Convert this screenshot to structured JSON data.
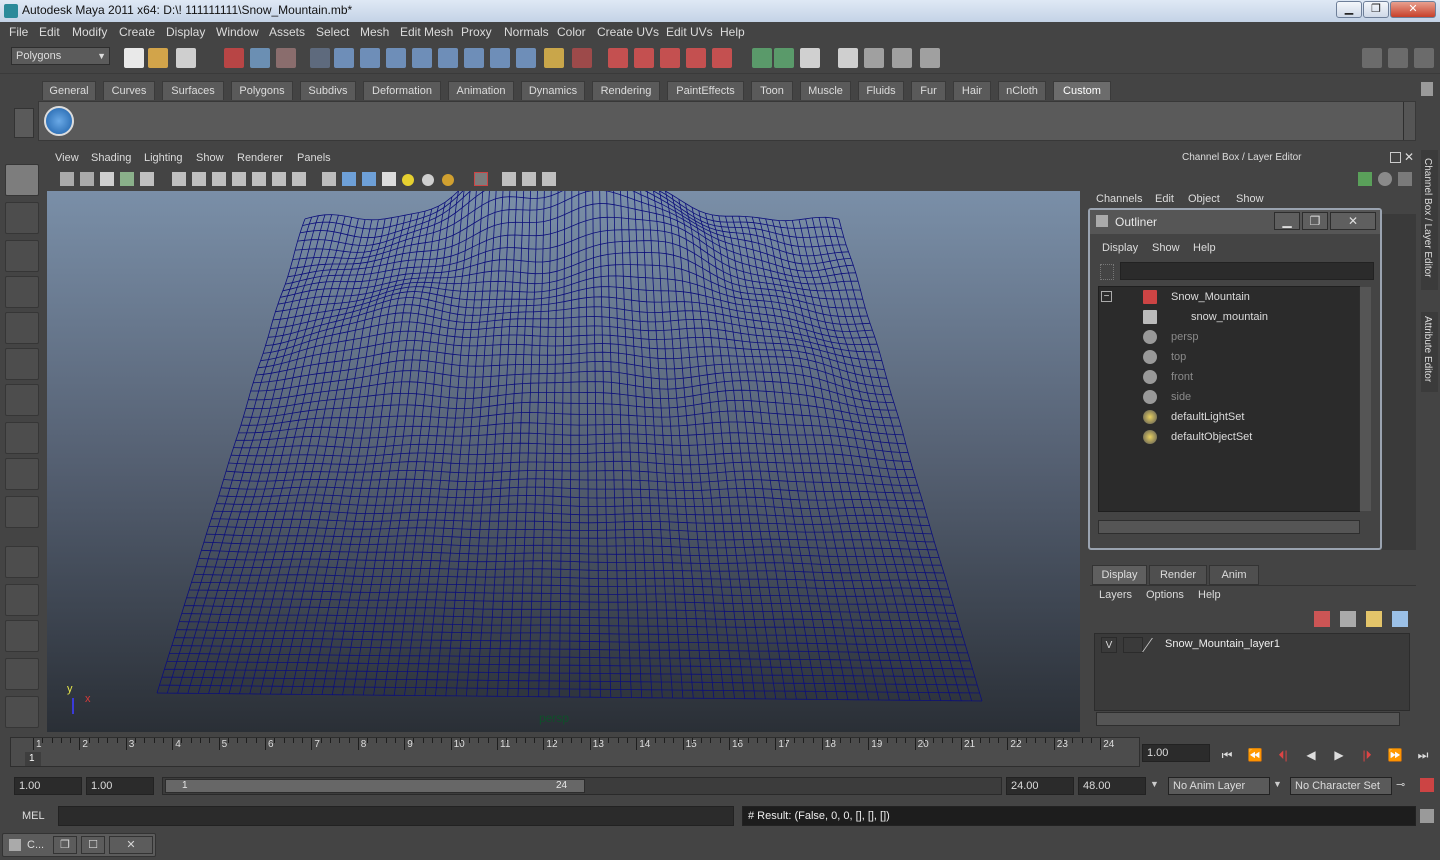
{
  "window": {
    "title": "Autodesk Maya 2011 x64: D:\\! 111111111\\Snow_Mountain.mb*",
    "minimize": "▁",
    "maximize": "❐",
    "close": "✕"
  },
  "menubar": [
    "File",
    "Edit",
    "Modify",
    "Create",
    "Display",
    "Window",
    "Assets",
    "Select",
    "Mesh",
    "Edit Mesh",
    "Proxy",
    "Normals",
    "Color",
    "Create UVs",
    "Edit UVs",
    "Help"
  ],
  "statusline": {
    "mode": "Polygons"
  },
  "shelf": {
    "tabs": [
      "General",
      "Curves",
      "Surfaces",
      "Polygons",
      "Subdivs",
      "Deformation",
      "Animation",
      "Dynamics",
      "Rendering",
      "PaintEffects",
      "Toon",
      "Muscle",
      "Fluids",
      "Fur",
      "Hair",
      "nCloth",
      "Custom"
    ],
    "active_tab": "Custom"
  },
  "viewport": {
    "menu": [
      "View",
      "Shading",
      "Lighting",
      "Show",
      "Renderer",
      "Panels"
    ],
    "camera": "persp",
    "axis_y": "y",
    "axis_x": "x",
    "wire_color": "#0c0f7a"
  },
  "channelbox": {
    "header": "Channel Box / Layer Editor",
    "menu": [
      "Channels",
      "Edit",
      "Object",
      "Show"
    ],
    "side_tabs": [
      "Channel Box / Layer Editor",
      "Attribute Editor"
    ]
  },
  "outliner": {
    "title": "Outliner",
    "menu": [
      "Display",
      "Show",
      "Help"
    ],
    "items": [
      {
        "label": "Snow_Mountain",
        "dim": false,
        "icon": "mesh-transform-icon"
      },
      {
        "label": "snow_mountain",
        "dim": false,
        "icon": "mesh-shape-icon"
      },
      {
        "label": "persp",
        "dim": true,
        "icon": "camera-icon"
      },
      {
        "label": "top",
        "dim": true,
        "icon": "camera-icon"
      },
      {
        "label": "front",
        "dim": true,
        "icon": "camera-icon"
      },
      {
        "label": "side",
        "dim": true,
        "icon": "camera-icon"
      },
      {
        "label": "defaultLightSet",
        "dim": false,
        "icon": "set-icon"
      },
      {
        "label": "defaultObjectSet",
        "dim": false,
        "icon": "set-icon"
      }
    ],
    "collapse": "−"
  },
  "layereditor": {
    "tabs": [
      "Display",
      "Render",
      "Anim"
    ],
    "active_tab": "Display",
    "menu": [
      "Layers",
      "Options",
      "Help"
    ],
    "layers": [
      {
        "visible": "V",
        "name": "Snow_Mountain_layer1"
      }
    ]
  },
  "timeline": {
    "frames": [
      "1",
      "2",
      "3",
      "4",
      "5",
      "6",
      "7",
      "8",
      "9",
      "10",
      "11",
      "12",
      "13",
      "14",
      "15",
      "16",
      "17",
      "18",
      "19",
      "20",
      "21",
      "22",
      "23",
      "24"
    ],
    "current_frame_marker": "1",
    "current_time": "1.00"
  },
  "range": {
    "start_time": "1.00",
    "playback_start": "1.00",
    "slider_start": "1",
    "slider_end": "24",
    "playback_end": "24.00",
    "end_time": "48.00",
    "anim_layer": "No Anim Layer",
    "character_set": "No Character Set"
  },
  "playback": [
    "⏮",
    "⏪",
    "⏴|",
    "◀",
    "▶",
    "|⏵",
    "⏩",
    "⏭"
  ],
  "cmdline": {
    "label": "MEL",
    "result": "# Result: (False, 0, 0, [], [], [])"
  },
  "taskbar": {
    "label": "C..."
  }
}
